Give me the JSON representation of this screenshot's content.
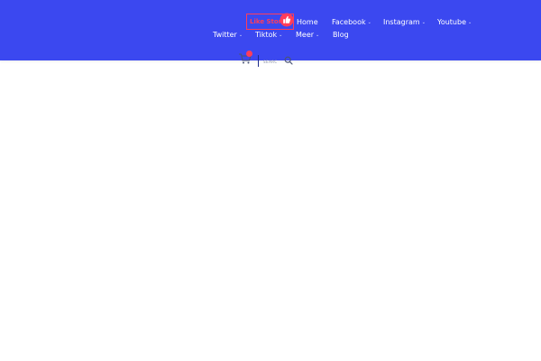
{
  "brand": {
    "logo_text": "Like Store",
    "accent": "#ff3d5a",
    "header_bg": "#3b48f0"
  },
  "nav": {
    "home": "Home",
    "facebook": "Facebook",
    "instagram": "Instagram",
    "youtube": "Youtube",
    "twitter": "Twitter",
    "tiktok": "Tiktok",
    "meer": "Meer",
    "blog": "Blog"
  },
  "icons": {
    "cart": "cart-icon",
    "search": "search-icon",
    "dropdown": "chevron-down-icon",
    "logo": "thumbs-up-icon"
  },
  "search": {
    "placeholder": "SEARC"
  }
}
